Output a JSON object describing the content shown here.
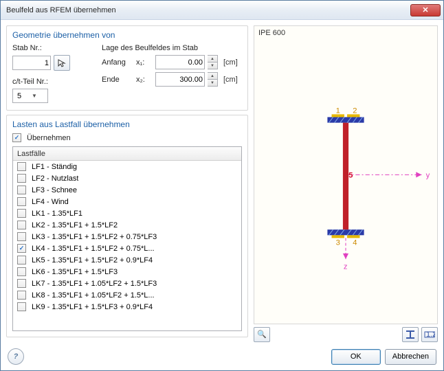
{
  "window": {
    "title": "Beulfeld aus RFEM übernehmen"
  },
  "geom": {
    "title": "Geometrie übernehmen von",
    "stab_label": "Stab Nr.:",
    "stab_value": "1",
    "lage_label": "Lage des Beulfeldes im Stab",
    "anfang": "Anfang",
    "x1": "x₁:",
    "x1_value": "0.00",
    "ende": "Ende",
    "x2": "x₂:",
    "x2_value": "300.00",
    "unit": "[cm]",
    "ct_label": "c/t-Teil Nr.:",
    "ct_value": "5"
  },
  "loads": {
    "title": "Lasten aus Lastfall übernehmen",
    "take": "Übernehmen",
    "header": "Lastfälle",
    "items": [
      {
        "checked": false,
        "label": "LF1 - Ständig"
      },
      {
        "checked": false,
        "label": "LF2 - Nutzlast"
      },
      {
        "checked": false,
        "label": "LF3 - Schnee"
      },
      {
        "checked": false,
        "label": "LF4 - Wind"
      },
      {
        "checked": false,
        "label": "LK1 - 1.35*LF1"
      },
      {
        "checked": false,
        "label": "LK2 - 1.35*LF1 + 1.5*LF2"
      },
      {
        "checked": false,
        "label": "LK3 - 1.35*LF1 + 1.5*LF2 + 0.75*LF3"
      },
      {
        "checked": true,
        "label": "LK4 - 1.35*LF1 + 1.5*LF2 + 0.75*L..."
      },
      {
        "checked": false,
        "label": "LK5 - 1.35*LF1 + 1.5*LF2 + 0.9*LF4"
      },
      {
        "checked": false,
        "label": "LK6 - 1.35*LF1 + 1.5*LF3"
      },
      {
        "checked": false,
        "label": "LK7 - 1.35*LF1 + 1.05*LF2 + 1.5*LF3"
      },
      {
        "checked": false,
        "label": "LK8 - 1.35*LF1 + 1.05*LF2 + 1.5*L..."
      },
      {
        "checked": false,
        "label": "LK9 - 1.35*LF1 + 1.5*LF3 + 0.9*LF4"
      }
    ]
  },
  "preview": {
    "profile": "IPE 600",
    "labels": {
      "n1": "1",
      "n2": "2",
      "n3": "3",
      "n4": "4",
      "n5": "5",
      "y": "y",
      "z": "z"
    }
  },
  "footer": {
    "ok": "OK",
    "cancel": "Abbrechen"
  }
}
